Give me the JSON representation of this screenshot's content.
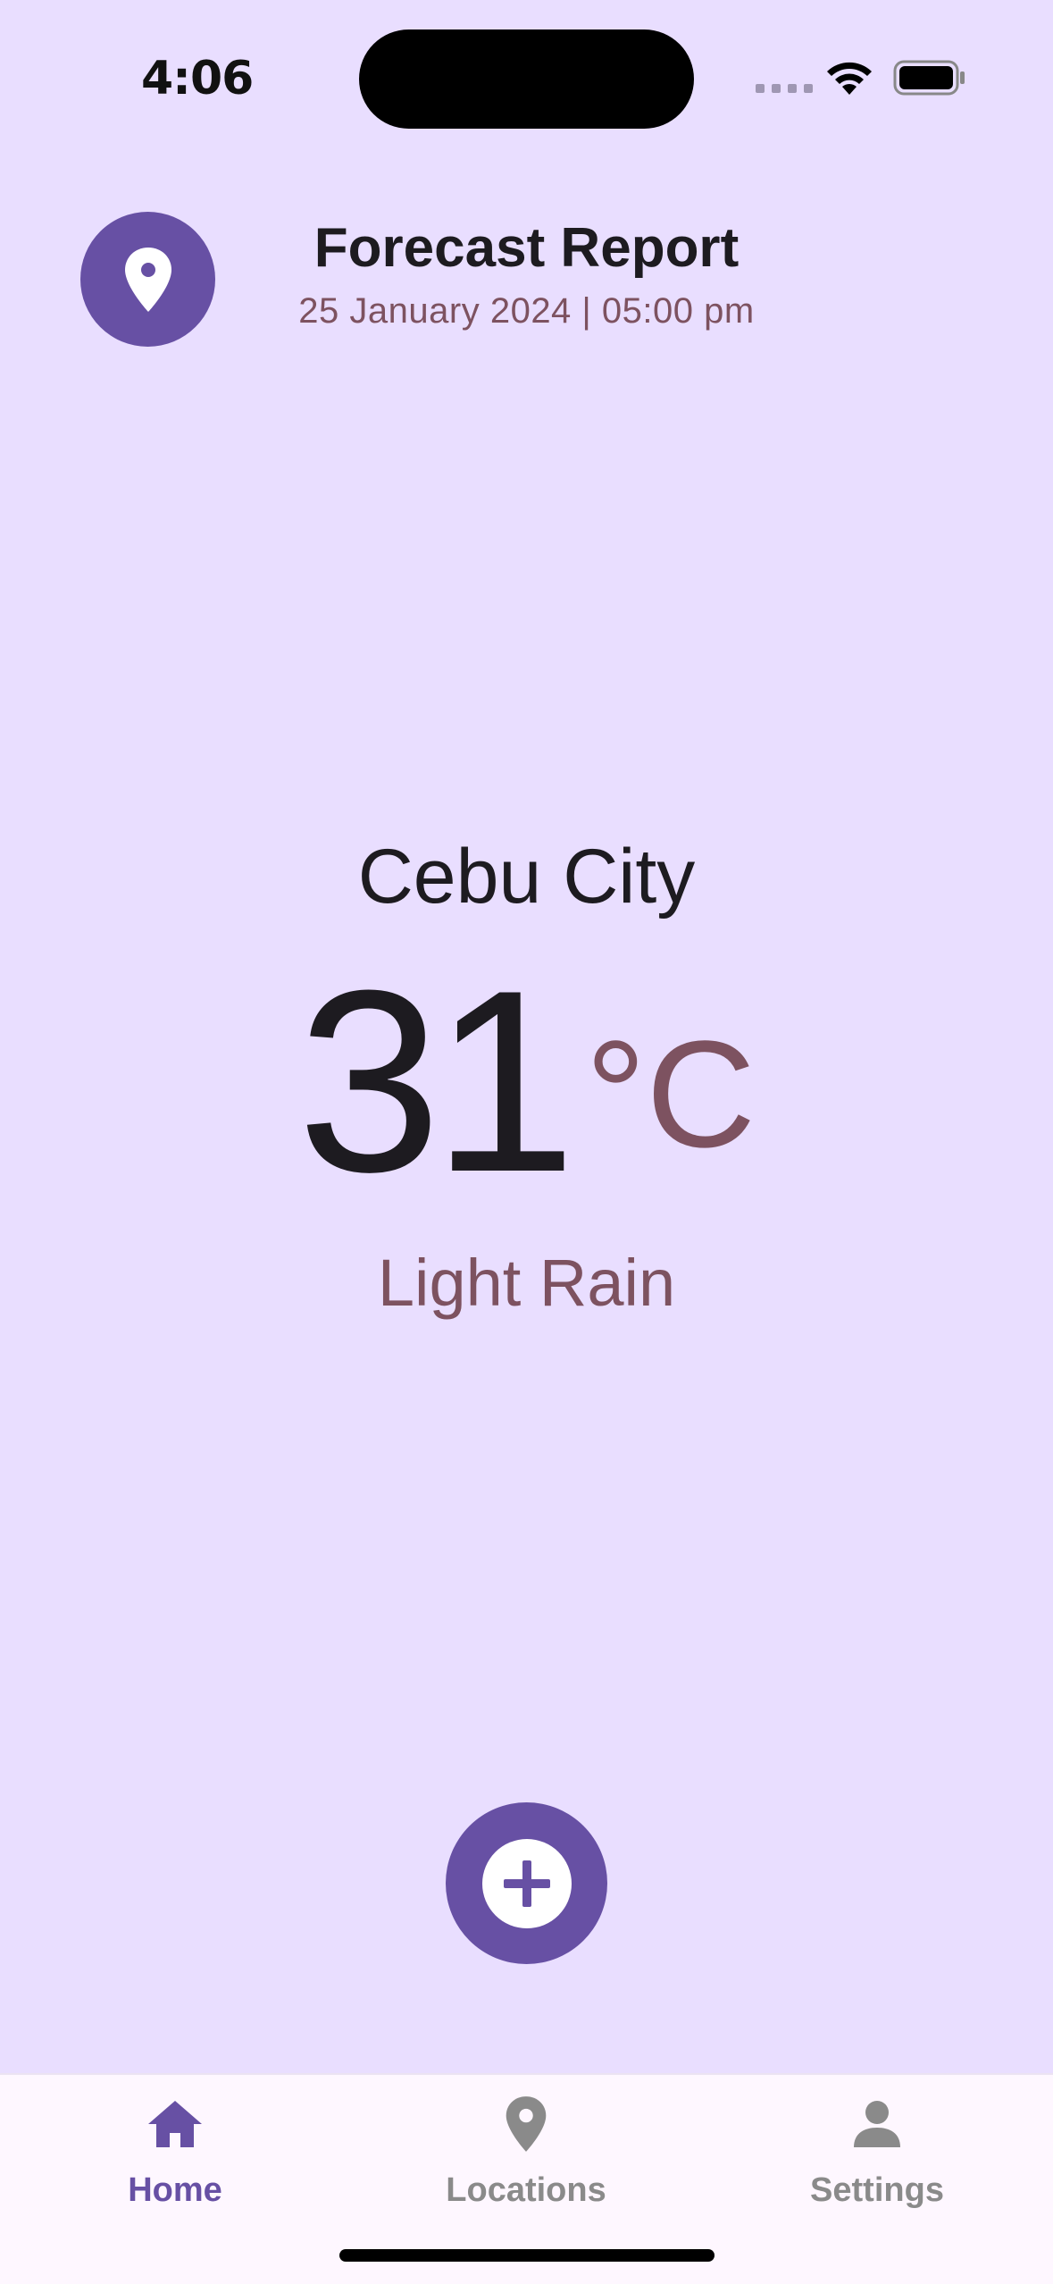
{
  "status_bar": {
    "time": "4:06"
  },
  "header": {
    "title": "Forecast Report",
    "subtitle": "25 January 2024 | 05:00 pm"
  },
  "weather": {
    "city": "Cebu City",
    "temperature": "31",
    "unit": "°C",
    "condition": "Light Rain"
  },
  "nav": {
    "items": [
      {
        "label": "Home",
        "icon": "home-icon",
        "active": true
      },
      {
        "label": "Locations",
        "icon": "location-pin-icon",
        "active": false
      },
      {
        "label": "Settings",
        "icon": "person-icon",
        "active": false
      }
    ]
  },
  "colors": {
    "background": "#E9DEFF",
    "primary": "#6750A4",
    "secondary_text": "#7D5260",
    "inactive_nav": "#8a8a8a",
    "nav_background": "#FEF7FF"
  }
}
